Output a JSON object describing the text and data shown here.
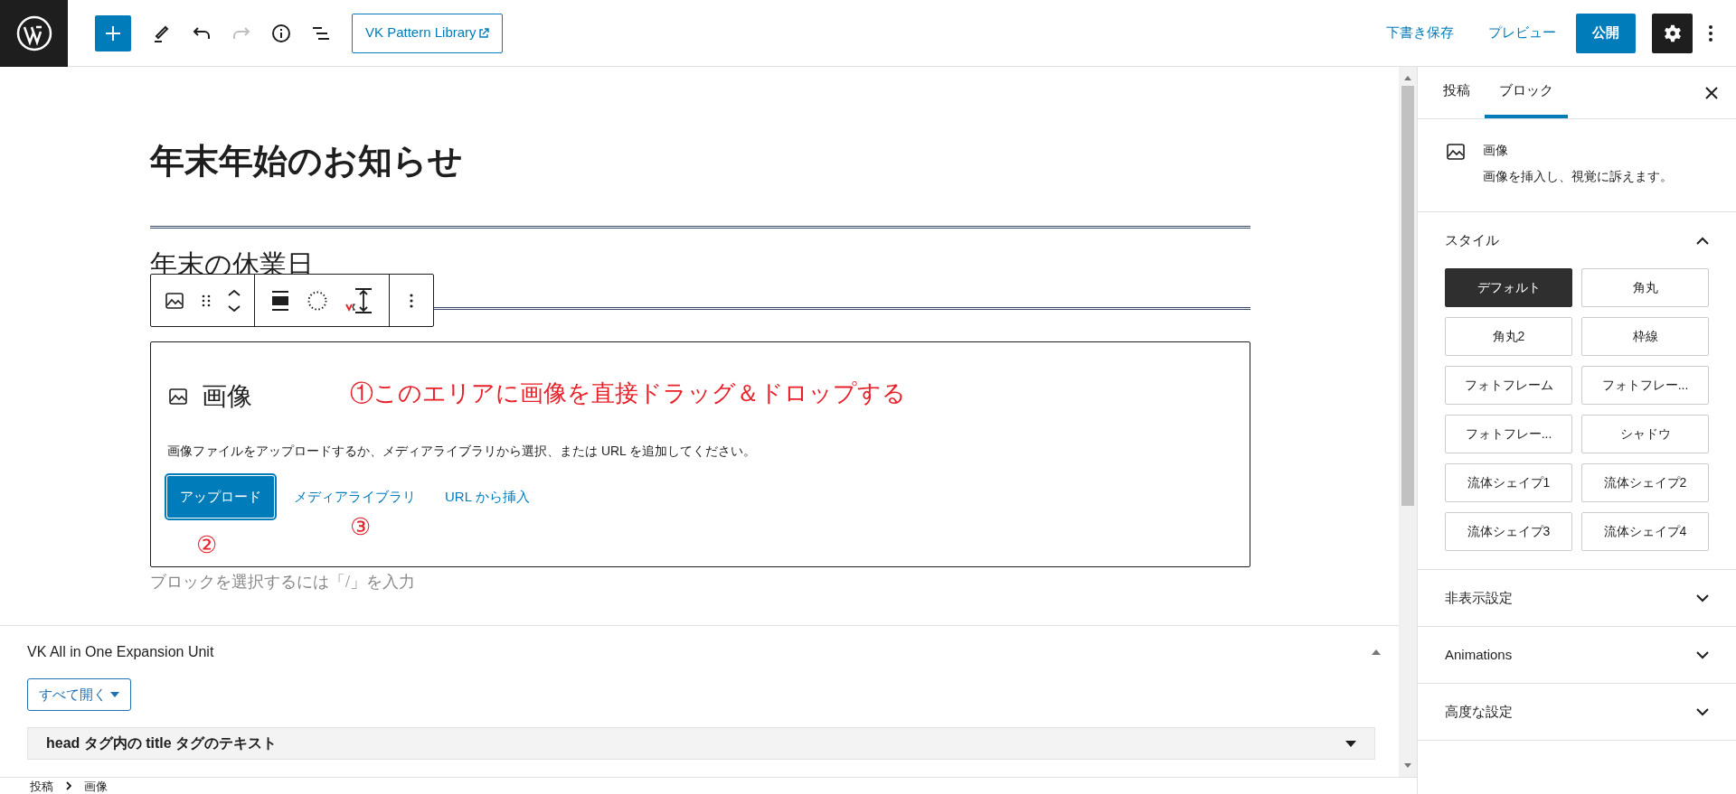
{
  "topbar": {
    "pattern_button": "VK Pattern Library",
    "save_draft": "下書き保存",
    "preview": "プレビュー",
    "publish": "公開"
  },
  "editor": {
    "title": "年末年始のお知らせ",
    "heading": "年末の休業日",
    "image_block": {
      "label": "画像",
      "instructions": "画像ファイルをアップロードするか、メディアライブラリから選択、または URL を追加してください。",
      "upload": "アップロード",
      "media_library": "メディアライブラリ",
      "url_insert": "URL から挿入"
    },
    "annotation_drop": "①このエリアに画像を直接ドラッグ＆ドロップする",
    "annotation_upload": "②",
    "annotation_media": "③",
    "appender_placeholder": "ブロックを選択するには「/」を入力"
  },
  "meta_box": {
    "title": "VK All in One Expansion Unit",
    "expand_all": "すべて開く",
    "rows": [
      {
        "label": "head タグ内の title タグのテキスト"
      }
    ]
  },
  "breadcrumb": [
    "投稿",
    "画像"
  ],
  "sidebar": {
    "tabs": [
      {
        "label": "投稿",
        "selected": false
      },
      {
        "label": "ブロック",
        "selected": true
      }
    ],
    "block": {
      "name": "画像",
      "description": "画像を挿入し、視覚に訴えます。"
    },
    "panels": [
      {
        "title": "スタイル",
        "expanded": true,
        "styles": [
          {
            "label": "デフォルト",
            "selected": true
          },
          {
            "label": "角丸",
            "selected": false
          },
          {
            "label": "角丸2",
            "selected": false
          },
          {
            "label": "枠線",
            "selected": false
          },
          {
            "label": "フォトフレーム",
            "selected": false
          },
          {
            "label": "フォトフレー...",
            "selected": false
          },
          {
            "label": "フォトフレー...",
            "selected": false
          },
          {
            "label": "シャドウ",
            "selected": false
          },
          {
            "label": "流体シェイプ1",
            "selected": false
          },
          {
            "label": "流体シェイプ2",
            "selected": false
          },
          {
            "label": "流体シェイプ3",
            "selected": false
          },
          {
            "label": "流体シェイプ4",
            "selected": false
          }
        ]
      },
      {
        "title": "非表示設定",
        "expanded": false
      },
      {
        "title": "Animations",
        "expanded": false
      },
      {
        "title": "高度な設定",
        "expanded": false
      }
    ]
  }
}
